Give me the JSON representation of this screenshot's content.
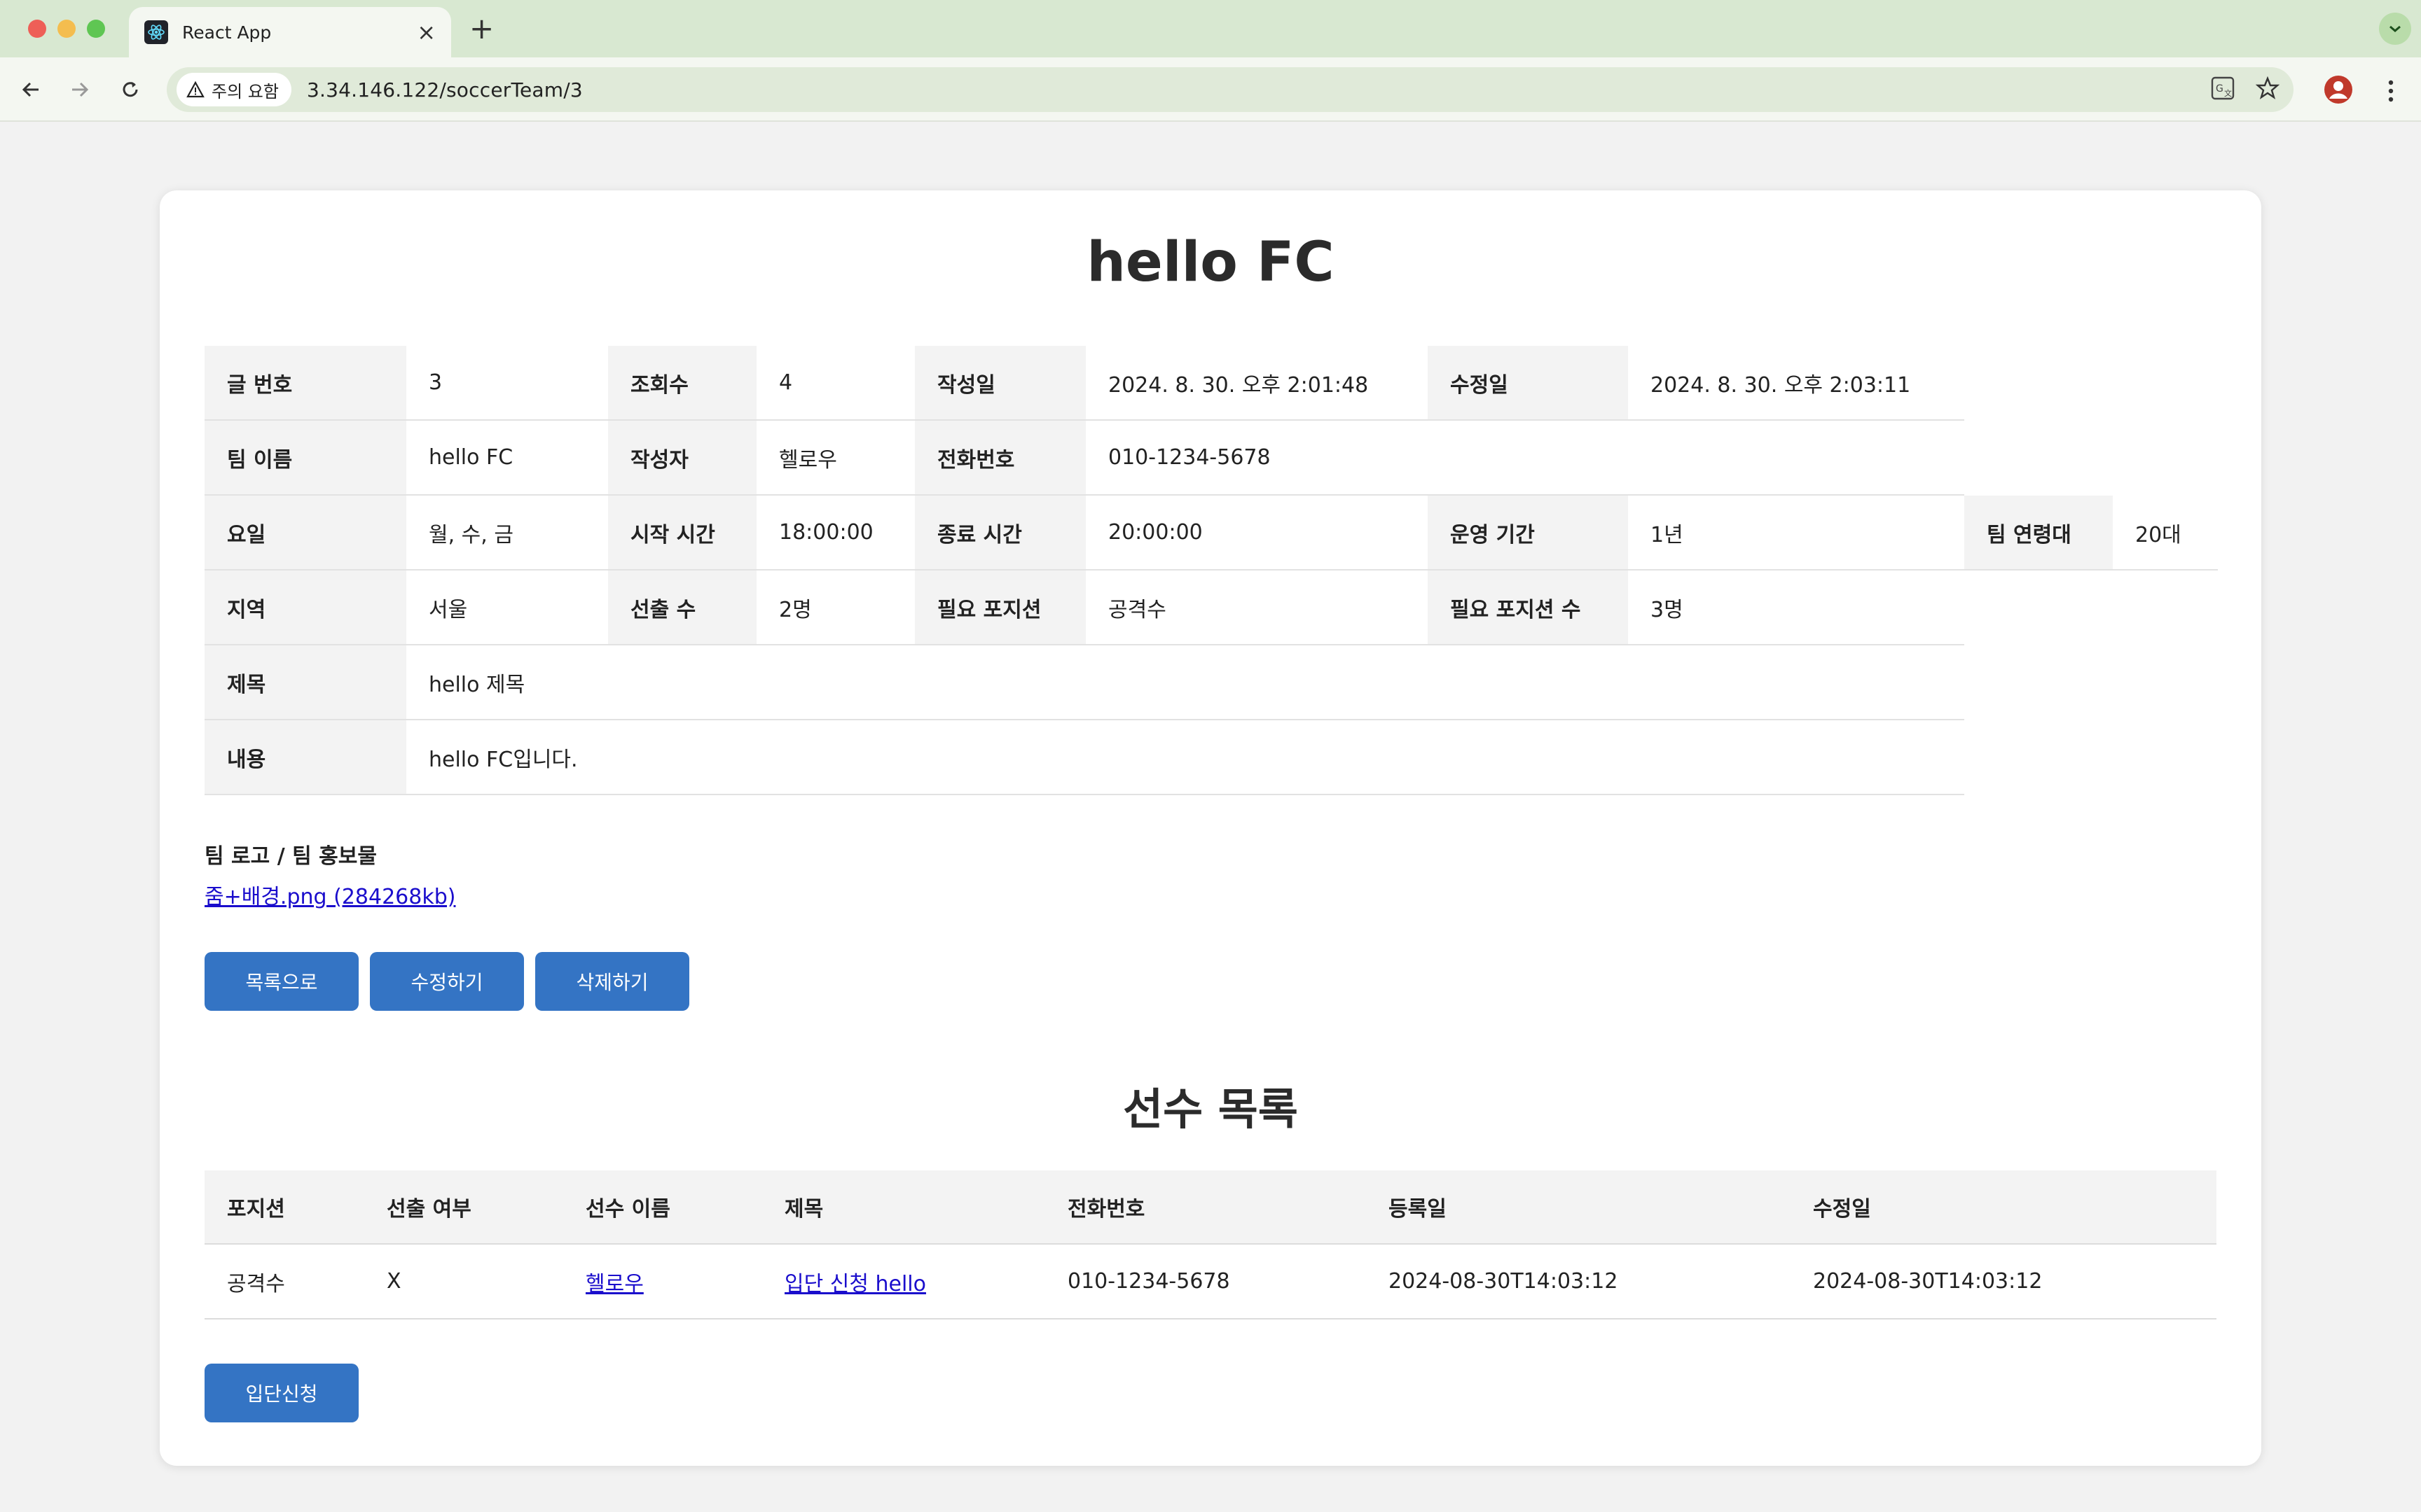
{
  "browser": {
    "tab_title": "React App",
    "security_label": "주의 요함",
    "url": "3.34.146.122/soccerTeam/3"
  },
  "page": {
    "title": "hello FC",
    "info_rows": [
      [
        {
          "label": "글 번호",
          "value": "3"
        },
        {
          "label": "조회수",
          "value": "4"
        },
        {
          "label": "작성일",
          "value": "2024. 8. 30. 오후 2:01:48"
        },
        {
          "label": "수정일",
          "value": "2024. 8. 30. 오후 2:03:11"
        }
      ],
      [
        {
          "label": "팀 이름",
          "value": "hello FC"
        },
        {
          "label": "작성자",
          "value": "헬로우"
        },
        {
          "label": "전화번호",
          "value": "010-1234-5678"
        }
      ],
      [
        {
          "label": "요일",
          "value": "월, 수, 금"
        },
        {
          "label": "시작 시간",
          "value": "18:00:00"
        },
        {
          "label": "종료 시간",
          "value": "20:00:00"
        },
        {
          "label": "운영 기간",
          "value": "1년"
        },
        {
          "label": "팀 연령대",
          "value": "20대"
        }
      ],
      [
        {
          "label": "지역",
          "value": "서울"
        },
        {
          "label": "선출 수",
          "value": "2명"
        },
        {
          "label": "필요 포지션",
          "value": "공격수"
        },
        {
          "label": "필요 포지션 수",
          "value": "3명"
        }
      ],
      [
        {
          "label": "제목",
          "value": "hello 제목"
        }
      ],
      [
        {
          "label": "내용",
          "value": "hello FC입니다."
        }
      ]
    ],
    "attachment_label": "팀 로고 / 팀 홍보물",
    "attachment_link": "줌+배경.png (284268kb)",
    "buttons": {
      "list": "목록으로",
      "edit": "수정하기",
      "delete": "삭제하기",
      "join": "입단신청"
    },
    "players_title": "선수 목록",
    "players_table": {
      "headers": [
        "포지션",
        "선출 여부",
        "선수 이름",
        "제목",
        "전화번호",
        "등록일",
        "수정일"
      ],
      "rows": [
        [
          "공격수",
          "X",
          "헬로우",
          "입단 신청 hello",
          "010-1234-5678",
          "2024-08-30T14:03:12",
          "2024-08-30T14:03:12"
        ]
      ]
    }
  },
  "colors": {
    "primary_button": "#3474c4",
    "link": "#1a0dcc",
    "label_bg": "#f3f3f3"
  }
}
